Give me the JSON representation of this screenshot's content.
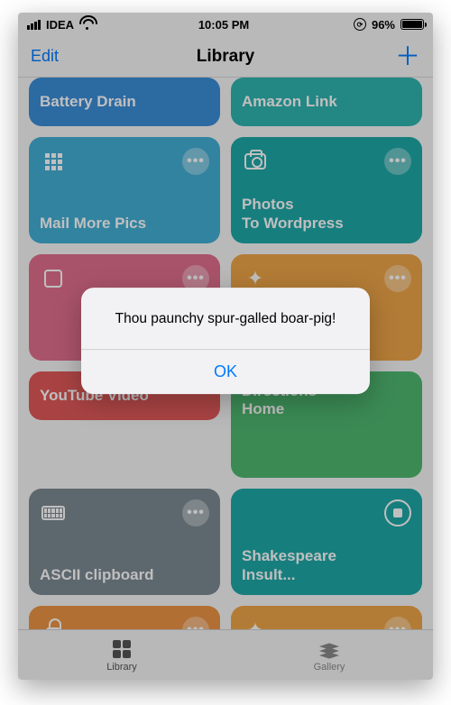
{
  "status": {
    "carrier": "IDEA",
    "time": "10:05 PM",
    "battery": "96%"
  },
  "nav": {
    "left": "Edit",
    "title": "Library",
    "right": "＋"
  },
  "cards": [
    {
      "title": "Battery Drain",
      "color": "c-blue",
      "icon": "none",
      "short": true
    },
    {
      "title": "Amazon Link",
      "color": "c-teal",
      "icon": "none",
      "short": true
    },
    {
      "title": "Mail More Pics",
      "color": "c-cyan",
      "icon": "grid9"
    },
    {
      "title": "Photos\nTo Wordpress",
      "color": "c-teal2",
      "icon": "camera"
    },
    {
      "title": "",
      "color": "c-pink",
      "icon": "square"
    },
    {
      "title": "",
      "color": "c-orange",
      "icon": "wand"
    },
    {
      "title": "YouTube Video",
      "color": "c-red",
      "icon": "none",
      "short": true
    },
    {
      "title": "Directions\nHome",
      "color": "c-green",
      "icon": "none",
      "short_bottom": true
    },
    {
      "title": "ASCII clipboard",
      "color": "c-gray",
      "icon": "keyboard"
    },
    {
      "title": "Shakespeare\nInsult...",
      "color": "c-teal2",
      "icon": "none",
      "running": true
    },
    {
      "title": "",
      "color": "c-orange2",
      "icon": "lock"
    },
    {
      "title": "",
      "color": "c-orange",
      "icon": "wand"
    }
  ],
  "tabs": {
    "library": "Library",
    "gallery": "Gallery"
  },
  "alert": {
    "message": "Thou paunchy spur-galled boar-pig!",
    "ok": "OK"
  }
}
